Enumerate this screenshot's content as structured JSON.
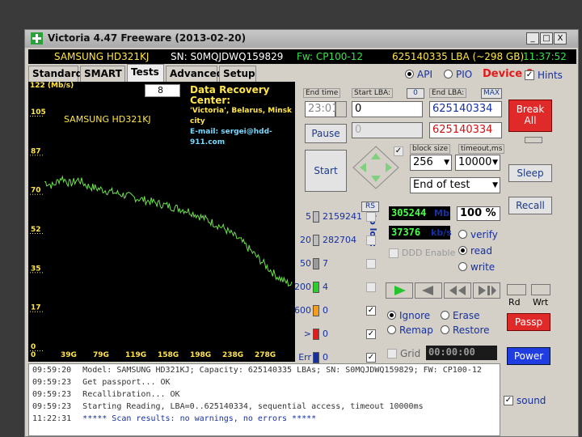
{
  "window": {
    "title": "Victoria 4.47  Freeware (2013-02-20)",
    "min": "_",
    "max": "□",
    "close": "X"
  },
  "infobar": {
    "model": "SAMSUNG HD321KJ",
    "serial": "SN: S0MQJDWQ159829",
    "firmware": "Fw: CP100-12",
    "capacity": "625140335 LBA (~298 GB)",
    "clock": "11:37:52"
  },
  "tabs": [
    "Standard",
    "SMART",
    "Tests",
    "Advanced",
    "Setup"
  ],
  "top_right": {
    "api": "API",
    "pio": "PIO",
    "device": "Device 0",
    "hints": "Hints"
  },
  "graph": {
    "unit": "122 (Mb/s)",
    "y_ticks": [
      "105",
      "87",
      "70",
      "52",
      "35",
      "17",
      "0"
    ],
    "x_ticks": [
      "39G",
      "79G",
      "119G",
      "158G",
      "198G",
      "238G",
      "278G"
    ],
    "model": "SAMSUNG HD321KJ",
    "spin_value": "8",
    "dr_title": "Data Recovery Center:",
    "dr_sub": "'Victoria', Belarus, Minsk city",
    "dr_email": "E-mail: sergei@hdd-911.com",
    "curve_mbps": [
      80,
      78,
      82,
      79,
      81,
      78,
      77,
      76,
      75,
      74,
      73,
      72,
      71,
      70,
      69,
      68,
      67,
      66,
      64,
      62,
      60,
      58,
      55,
      52,
      48,
      44,
      40,
      36,
      33,
      31
    ]
  },
  "controls": {
    "end_time_lbl": "End time",
    "start_lba_lbl": "Start LBA:",
    "start_lba_zero": "0",
    "end_lba_lbl": "End LBA:",
    "max_lbl": "MAX",
    "end_time": "23:01",
    "start_lba": "0",
    "end_lba": "625140334",
    "pause": "Pause",
    "start_lba2": "0",
    "end_lba2": "625140334",
    "start": "Start",
    "block_size_lbl": "block size",
    "timeout_lbl": "timeout,ms",
    "block_size": "256",
    "timeout": "10000",
    "end_of_test": "End of test"
  },
  "buttons": {
    "break_all": "Break All",
    "sleep": "Sleep",
    "recall": "Recall",
    "rd": "Rd",
    "wrt": "Wrt",
    "passp": "Passp",
    "power": "Power"
  },
  "histogram": {
    "rs": "RS",
    "to_log": "to log:",
    "rows": [
      {
        "label": "5",
        "count": "2159241",
        "color": "#bdbdbd"
      },
      {
        "label": "20",
        "count": "282704",
        "color": "#bdbdbd"
      },
      {
        "label": "50",
        "count": "7",
        "color": "#9a9a9a"
      },
      {
        "label": "200",
        "count": "4",
        "color": "#2ad02a"
      },
      {
        "label": "600",
        "count": "0",
        "color": "#f59c1a"
      },
      {
        "label": ">",
        "count": "0",
        "color": "#e21a1a"
      },
      {
        "label": "Err",
        "count": "0",
        "color": "#1630a0"
      }
    ]
  },
  "stats": {
    "mb": "305244",
    "mb_unit": "Mb",
    "percent": "100",
    "percent_unit": "%",
    "kbs": "37376",
    "kbs_unit": "kb/s",
    "verify": "verify",
    "read": "read",
    "write": "write",
    "ddd": "DDD Enable"
  },
  "modes": {
    "ignore": "Ignore",
    "erase": "Erase",
    "remap": "Remap",
    "restore": "Restore"
  },
  "grid": {
    "label": "Grid",
    "timer": "00:00:00"
  },
  "log": [
    {
      "time": "09:59:20",
      "msg": "Model: SAMSUNG HD321KJ; Capacity: 625140335 LBAs; SN: S0MQJDWQ159829; FW: CP100-12"
    },
    {
      "time": "09:59:23",
      "msg": "Get passport... OK"
    },
    {
      "time": "09:59:23",
      "msg": "Recallibration... OK"
    },
    {
      "time": "09:59:23",
      "msg": "Starting Reading, LBA=0..625140334, sequential access, timeout 10000ms"
    },
    {
      "time": "11:22:31",
      "msg": "***** Scan results: no warnings, no errors *****"
    }
  ],
  "sound": "sound"
}
